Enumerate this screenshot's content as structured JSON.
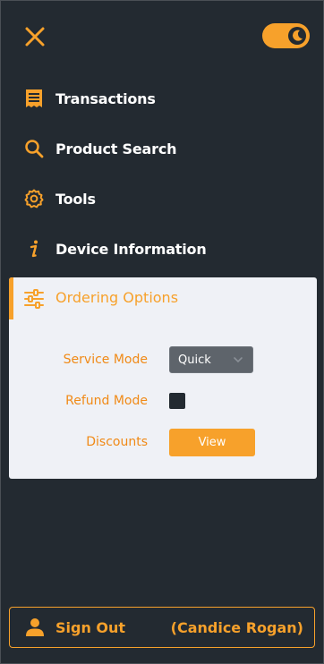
{
  "header": {
    "close_icon": "close-icon",
    "theme_toggle": {
      "state": "on",
      "icon": "moon-icon"
    }
  },
  "nav": {
    "items": [
      {
        "label": "Transactions",
        "icon": "receipt-icon"
      },
      {
        "label": "Product Search",
        "icon": "search-icon"
      },
      {
        "label": "Tools",
        "icon": "gear-icon"
      },
      {
        "label": "Device Information",
        "icon": "info-icon"
      }
    ],
    "ordering": {
      "label": "Ordering Options",
      "icon": "sliders-icon",
      "service_mode_label": "Service Mode",
      "service_mode_value": "Quick",
      "refund_mode_label": "Refund Mode",
      "refund_mode_checked": false,
      "discounts_label": "Discounts",
      "view_label": "View"
    }
  },
  "footer": {
    "signout_label": "Sign Out",
    "user_name": "(Candice Rogan)",
    "icon": "user-icon"
  },
  "colors": {
    "background": "#232a31",
    "accent": "#f7a12b",
    "panel": "#eff1f6",
    "text": "#ffffff"
  }
}
